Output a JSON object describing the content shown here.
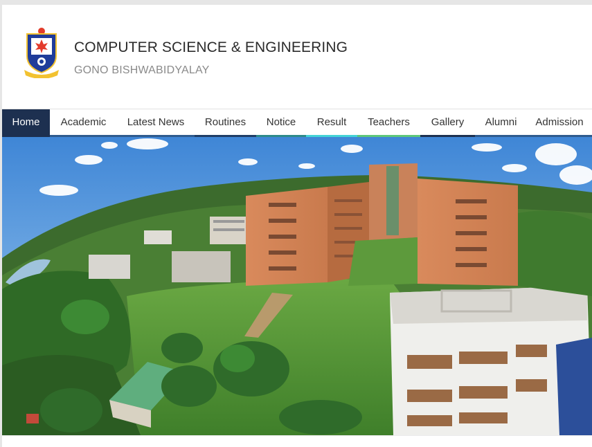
{
  "header": {
    "title": "COMPUTER SCIENCE & ENGINEERING",
    "subtitle": "GONO BISHWABIDYALAY",
    "logo_icon": "university-crest-icon"
  },
  "nav": {
    "items": [
      {
        "label": "Home",
        "active": true,
        "color": "#1d3050"
      },
      {
        "label": "Academic",
        "color": "#2f5b8e"
      },
      {
        "label": "Latest News",
        "color": "#2f5b8e"
      },
      {
        "label": "Routines",
        "color": "#1f3d66"
      },
      {
        "label": "Notice",
        "color": "#2e8a8a"
      },
      {
        "label": "Result",
        "color": "#45d3d6"
      },
      {
        "label": "Teachers",
        "color": "#5fc77a"
      },
      {
        "label": "Gallery",
        "color": "#1d3050"
      },
      {
        "label": "Alumni",
        "color": "#2f5b8e"
      },
      {
        "label": "Admission",
        "color": "#2f5b8e"
      }
    ]
  },
  "hero": {
    "image_icon": "campus-panorama-image"
  },
  "colors": {
    "nav_active_bg": "#1d3050",
    "title_text": "#2b2b2b",
    "subtitle_text": "#8a8a8a"
  }
}
